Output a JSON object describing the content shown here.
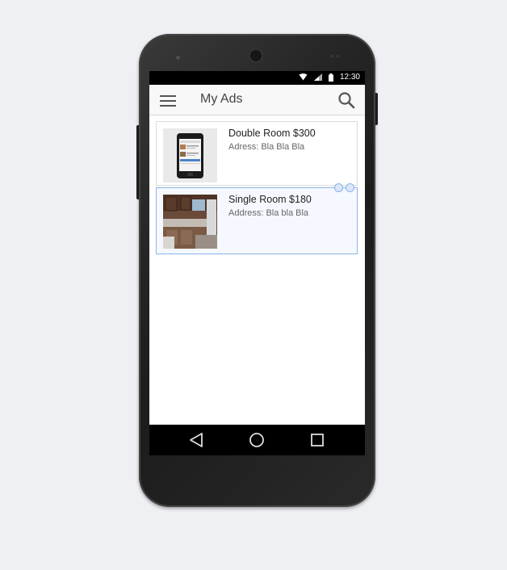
{
  "status_bar": {
    "time": "12:30",
    "icons": [
      "wifi-icon",
      "signal-icon",
      "battery-icon"
    ]
  },
  "app_bar": {
    "title": "My Ads",
    "menu_icon": "hamburger-menu-icon",
    "search_icon": "search-icon"
  },
  "ads": [
    {
      "title": "Double Room $300",
      "address": "Adress: Bla Bla Bla",
      "thumbnail": "phone-thumbnail"
    },
    {
      "title": "Single Room $180",
      "address": "Address: Bla bla Bla",
      "thumbnail": "kitchen-thumbnail"
    }
  ],
  "nav_bar": {
    "buttons": [
      "back-icon",
      "home-icon",
      "recents-icon"
    ]
  },
  "colors": {
    "page_background": "#eff0f4",
    "selection_border": "#8fb3e6",
    "app_bar_background": "#f8f8f8"
  }
}
